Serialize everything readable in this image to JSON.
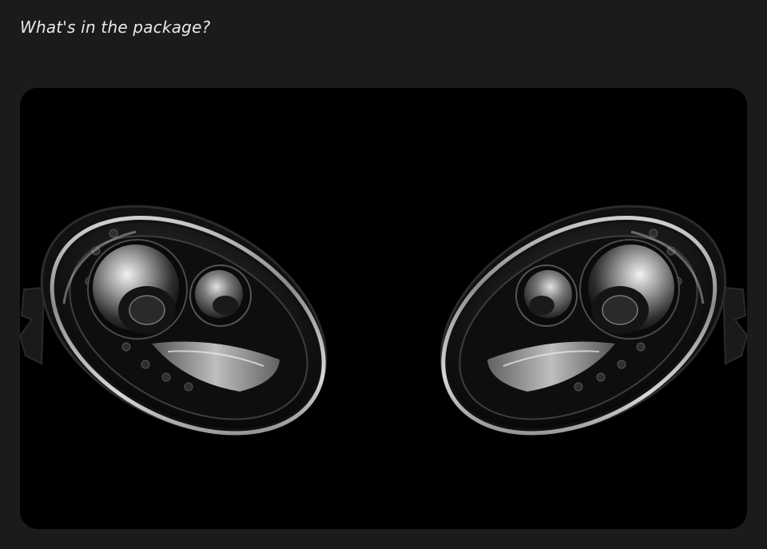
{
  "section": {
    "heading": "What's in the package?"
  },
  "photo": {
    "subject": "pair-of-headlights",
    "background_color": "#000000",
    "page_background_color": "#1b1b1b"
  }
}
